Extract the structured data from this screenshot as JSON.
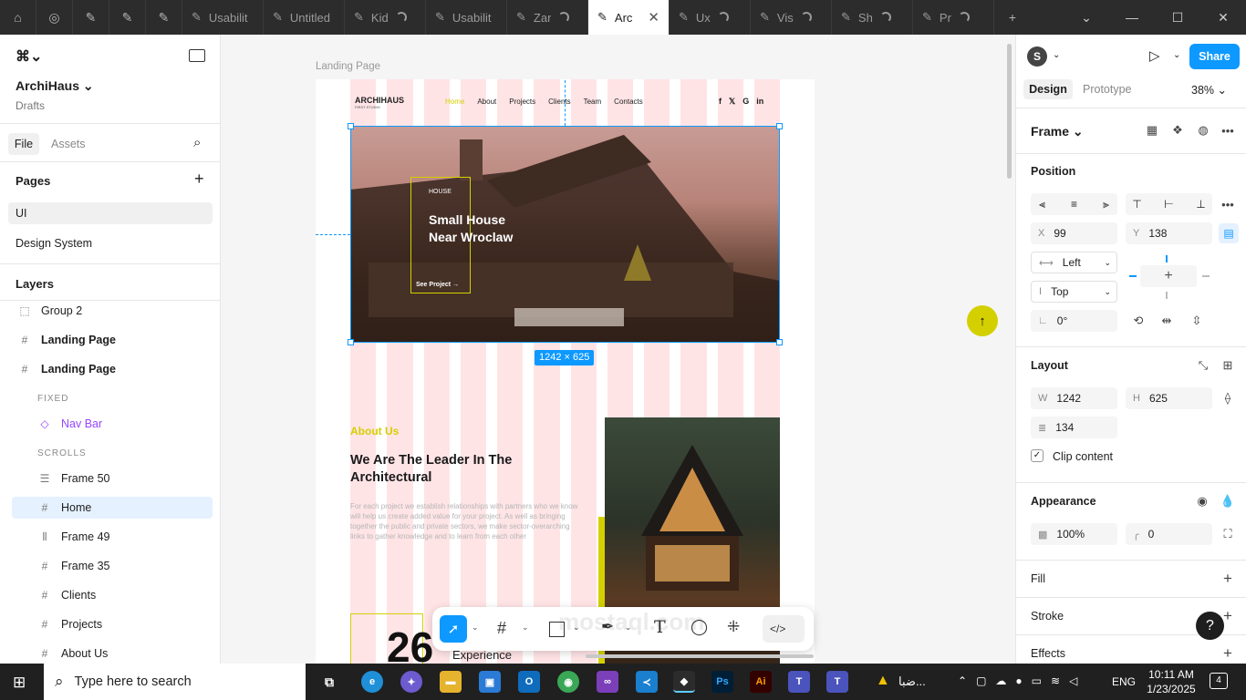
{
  "tabs": [
    {
      "label": "Usabilit",
      "loading": false
    },
    {
      "label": "Untitled",
      "loading": false
    },
    {
      "label": "Kid",
      "loading": true
    },
    {
      "label": "Usabilit",
      "loading": false
    },
    {
      "label": "Zar",
      "loading": true
    },
    {
      "label": "Arc",
      "loading": false,
      "active": true
    },
    {
      "label": "Ux",
      "loading": true
    },
    {
      "label": "Vis",
      "loading": true
    },
    {
      "label": "Sh",
      "loading": true
    },
    {
      "label": "Pr",
      "loading": true
    }
  ],
  "left": {
    "project": "ArchiHaus",
    "location": "Drafts",
    "tab_file": "File",
    "tab_assets": "Assets",
    "pages_title": "Pages",
    "pages": [
      "UI",
      "Design System"
    ],
    "layers_title": "Layers",
    "layers": [
      {
        "name": "Group 2",
        "icon": "group-icon"
      },
      {
        "name": "Landing Page",
        "icon": "frame-icon",
        "bold": true
      },
      {
        "name": "Landing Page",
        "icon": "frame-icon",
        "bold": true
      },
      {
        "name": "FIXED",
        "header": true
      },
      {
        "name": "Nav Bar",
        "icon": "component-icon",
        "component": true
      },
      {
        "name": "SCROLLS",
        "header": true
      },
      {
        "name": "Frame 50",
        "icon": "stack-icon"
      },
      {
        "name": "Home",
        "icon": "frame-icon",
        "selected": true
      },
      {
        "name": "Frame 49",
        "icon": "columns-icon"
      },
      {
        "name": "Frame 35",
        "icon": "frame-icon"
      },
      {
        "name": "Clients",
        "icon": "frame-icon"
      },
      {
        "name": "Projects",
        "icon": "frame-icon"
      },
      {
        "name": "About Us",
        "icon": "frame-icon"
      }
    ]
  },
  "canvas": {
    "frame_label": "Landing Page",
    "size_badge": "1242 × 625",
    "site": {
      "logo": "ARCHIHAUS",
      "logo_sub": "FIRST STUDIO",
      "nav": [
        "Home",
        "About",
        "Projects",
        "Clients",
        "Team",
        "Contacts"
      ],
      "hero_tag": "HOUSE",
      "hero_title": "Small House Near Wroclaw",
      "hero_link": "See Project →",
      "about_tag": "About Us",
      "about_title": "We Are The Leader In The Architectural",
      "about_body": "For each project we establish relationships with partners who we know will help us create added value for your project. As well as bringing together the public and private sectors, we make sector-overarching links to gather knowledge and to learn from each other",
      "stat_number": "26",
      "stat_label": "Experience"
    },
    "watermark": "mostaql.com"
  },
  "right": {
    "avatar": "S",
    "share": "Share",
    "tab_design": "Design",
    "tab_prototype": "Prototype",
    "zoom": "38%",
    "frame": "Frame",
    "position_title": "Position",
    "x": "99",
    "y": "138",
    "h_constraint": "Left",
    "v_constraint": "Top",
    "rotation": "0°",
    "layout_title": "Layout",
    "w": "1242",
    "h": "625",
    "gap": "134",
    "clip": "Clip content",
    "appearance_title": "Appearance",
    "opacity": "100%",
    "radius": "0",
    "fill_title": "Fill",
    "stroke_title": "Stroke",
    "effects_title": "Effects"
  },
  "taskbar": {
    "search": "Type here to search",
    "tray_text": "ضبا...",
    "lang": "ENG",
    "time": "10:11 AM",
    "date": "1/23/2025",
    "notif": "4"
  },
  "colors": {
    "accent": "#0d99ff",
    "yellow": "#d4d000",
    "pink": "#ffe4e6"
  }
}
